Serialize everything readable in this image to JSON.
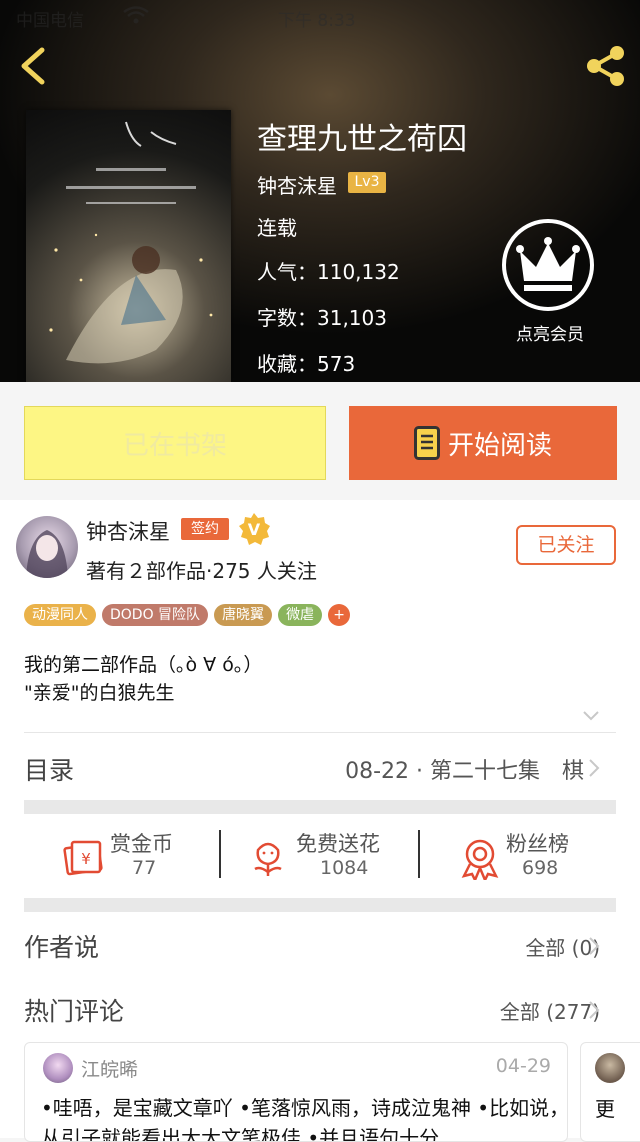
{
  "status_bar": {
    "carrier": "中国电信",
    "time": "下午 8:33"
  },
  "book": {
    "title": "查理九世之荷囚",
    "author": "钟杏沫星",
    "author_level": "Lv3",
    "status": "连载",
    "popularity": "人气：110,132",
    "word_count": "字数：31,103",
    "favorites": "收藏：573",
    "vip_label": "点亮会员"
  },
  "actions": {
    "shelf_label": "已在书架",
    "read_label": "开始阅读"
  },
  "author_panel": {
    "name": "钟杏沫星",
    "sign_badge": "签约",
    "meta": "著有２部作品·275 人关注",
    "follow_label": "已关注"
  },
  "tags": [
    {
      "label": "动漫同人",
      "color": "#eab24a"
    },
    {
      "label": "DODO 冒险队",
      "color": "#c07a6a"
    },
    {
      "label": "唐晓翼",
      "color": "#c99a52"
    },
    {
      "label": "微虐",
      "color": "#8ab45c"
    }
  ],
  "tags_more": "+",
  "description": {
    "line1": "我的第二部作品（｡ò ∀ ó｡）",
    "line2": "\"亲爱\"的白狼先生"
  },
  "toc": {
    "label": "目录",
    "latest": "08-22 · 第二十七集　棋"
  },
  "rewards": [
    {
      "label": "赏金币",
      "value": "77",
      "icon": "coin-envelope-icon"
    },
    {
      "label": "免费送花",
      "value": "1084",
      "icon": "flower-icon"
    },
    {
      "label": "粉丝榜",
      "value": "698",
      "icon": "medal-icon"
    }
  ],
  "author_says": {
    "title": "作者说",
    "link": "全部 (0)"
  },
  "hot_comments": {
    "title": "热门评论",
    "link": "全部 (277)"
  },
  "comments": [
    {
      "user": "江皖晞",
      "date": "04-29",
      "text": "•哇唔，是宝藏文章吖 •笔落惊风雨，诗成泣鬼神 •比如说，从引子就能看出大大文笔极佳 •并且语句十分"
    },
    {
      "text": "更"
    }
  ],
  "colors": {
    "accent": "#e9683a",
    "shelf_yellow": "#fdf684",
    "level_gold": "#e9b444"
  }
}
